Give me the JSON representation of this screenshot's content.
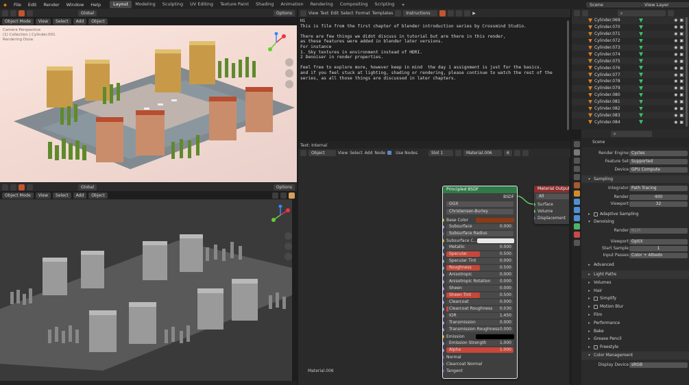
{
  "menu": [
    "File",
    "Edit",
    "Render",
    "Window",
    "Help"
  ],
  "workspaces": [
    "Layout",
    "Modeling",
    "Sculpting",
    "UV Editing",
    "Texture Paint",
    "Shading",
    "Animation",
    "Rendering",
    "Compositing",
    "Scripting"
  ],
  "active_workspace": "Layout",
  "topbar_right": {
    "scene": "Scene",
    "view_layer": "View Layer"
  },
  "viewport1": {
    "header": {
      "mode": "Object Mode",
      "view": "View",
      "select": "Select",
      "add": "Add",
      "object": "Object",
      "orientation": "Global",
      "options": "Options"
    },
    "overlay": [
      "Camera Perspective",
      "(1) Collection | Cylinder.001",
      "Rendering Done"
    ]
  },
  "viewport2": {
    "header": {
      "mode": "Object Mode",
      "view": "View",
      "select": "Select",
      "add": "Add",
      "object": "Object",
      "orientation": "Global",
      "options": "Options"
    }
  },
  "text_editor": {
    "header": {
      "view": "View",
      "text": "Text",
      "edit": "Edit",
      "select": "Select",
      "format": "Format",
      "templates": "Templates",
      "filename": "Instructions"
    },
    "lines": [
      "Hi",
      "This is file from the first chapter of blender introduction series by Crossmind Studio.",
      "",
      "There are few things we didnt discuss in tutorial but are there in this render,",
      "as these features were added in blender later versions.",
      "For instance",
      "1. Sky textures in environment instead of HDRI.",
      "2 Denoiser in render properties.",
      "",
      "Feel free to explore more, however keep in mind  the day 1 assignment is just for the basics.",
      "and if you feel stuck at lighting, shading or rendering, please continue to watch the rest of the",
      "series, as all those things are discussed in later chapters."
    ],
    "footer": "Text: Internal"
  },
  "node_editor": {
    "header": {
      "type": "Object",
      "view": "View",
      "select": "Select",
      "add": "Add",
      "node": "Node",
      "use_nodes": "Use Nodes",
      "slot": "Slot 1",
      "material": "Material.006",
      "users": "6"
    },
    "material_label": "Material.006",
    "bsdf": {
      "title": "Principled BSDF",
      "output": "BSDF",
      "distribution": "GGX",
      "subsurface_method": "Christensen-Burley",
      "rows": [
        {
          "name": "Base Color",
          "value": "",
          "kind": "color",
          "color": "#8a3a17"
        },
        {
          "name": "Subsurface",
          "value": "0.000"
        },
        {
          "name": "Subsurface Radius",
          "value": "",
          "kind": "dropdown"
        },
        {
          "name": "Subsurface C...",
          "value": "",
          "kind": "color",
          "color": "#e8e8e8"
        },
        {
          "name": "Metallic",
          "value": "0.000"
        },
        {
          "name": "Specular",
          "value": "0.500",
          "fill": 0.5
        },
        {
          "name": "Specular Tint",
          "value": "0.000"
        },
        {
          "name": "Roughness",
          "value": "0.500",
          "fill": 0.5
        },
        {
          "name": "Anisotropic",
          "value": "0.000"
        },
        {
          "name": "Anisotropic Rotation",
          "value": "0.000"
        },
        {
          "name": "Sheen",
          "value": "0.000"
        },
        {
          "name": "Sheen Tint",
          "value": "0.500",
          "fill": 0.5
        },
        {
          "name": "Clearcoat",
          "value": "0.000"
        },
        {
          "name": "Clearcoat Roughness",
          "value": "0.030",
          "fill": 0.03
        },
        {
          "name": "IOR",
          "value": "1.450"
        },
        {
          "name": "Transmission",
          "value": "0.000"
        },
        {
          "name": "Transmission Roughness",
          "value": "0.000"
        },
        {
          "name": "Emission",
          "value": "",
          "kind": "color",
          "color": "#000000"
        },
        {
          "name": "Emission Strength",
          "value": "1.000"
        },
        {
          "name": "Alpha",
          "value": "1.000",
          "fill": 1.0
        },
        {
          "name": "Normal",
          "value": "",
          "kind": "label"
        },
        {
          "name": "Clearcoat Normal",
          "value": "",
          "kind": "label"
        },
        {
          "name": "Tangent",
          "value": "",
          "kind": "label"
        }
      ]
    },
    "output_node": {
      "title": "Material Output",
      "target": "All",
      "sockets": [
        "Surface",
        "Volume",
        "Displacement"
      ]
    }
  },
  "outliner": {
    "items": [
      "Cylinder.069",
      "Cylinder.070",
      "Cylinder.071",
      "Cylinder.072",
      "Cylinder.073",
      "Cylinder.074",
      "Cylinder.075",
      "Cylinder.076",
      "Cylinder.077",
      "Cylinder.078",
      "Cylinder.079",
      "Cylinder.080",
      "Cylinder.081",
      "Cylinder.082",
      "Cylinder.083",
      "Cylinder.084"
    ]
  },
  "properties": {
    "scene": "Scene",
    "render_engine": {
      "label": "Render Engine",
      "value": "Cycles"
    },
    "feature_set": {
      "label": "Feature Set",
      "value": "Supported"
    },
    "device": {
      "label": "Device",
      "value": "GPU Compute"
    },
    "sampling": "Sampling",
    "integrator": {
      "label": "Integrator",
      "value": "Path Tracing"
    },
    "render": {
      "label": "Render",
      "value": "400"
    },
    "viewport": {
      "label": "Viewport",
      "value": "32"
    },
    "adaptive_sampling": "Adaptive Sampling",
    "denoising": "Denoising",
    "denoise_render": {
      "label": "Render",
      "value": "NLM"
    },
    "denoise_viewport": {
      "label": "Viewport",
      "value": "OptiX"
    },
    "start_sample": {
      "label": "Start Sample",
      "value": "1"
    },
    "input_passes": {
      "label": "Input Passes",
      "value": "Color + Albedo"
    },
    "advanced": "Advanced",
    "sections": [
      "Light Paths",
      "Volumes",
      "Hair",
      "Simplify",
      "Motion Blur",
      "Film",
      "Performance",
      "Bake",
      "Grease Pencil",
      "Freestyle",
      "Color Management"
    ],
    "display_device": {
      "label": "Display Device",
      "value": "sRGB"
    }
  }
}
